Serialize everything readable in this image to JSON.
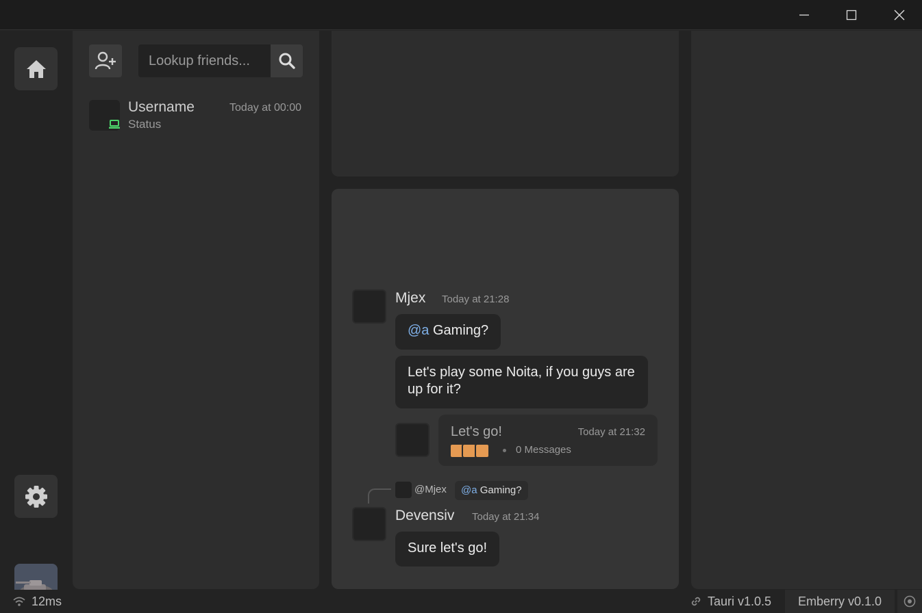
{
  "window": {
    "controls": {
      "minimize": "minimize-icon",
      "maximize": "maximize-icon",
      "close": "close-icon"
    }
  },
  "rail": {
    "home_icon": "home-icon",
    "settings_icon": "gear-icon"
  },
  "friends": {
    "add_friend_icon": "add-user-icon",
    "search": {
      "placeholder": "Lookup friends...",
      "value": ""
    },
    "list": [
      {
        "name": "Username",
        "time": "Today at 00:00",
        "status": "Status",
        "device_icon": "laptop-icon",
        "device_color": "#4cd36a"
      }
    ]
  },
  "chat": {
    "messages": [
      {
        "author": "Mjex",
        "time": "Today at 21:28",
        "bubbles": [
          {
            "mention": "@a",
            "text": " Gaming?"
          },
          {
            "text": "Let's play some Noita, if you guys are up for it?"
          }
        ],
        "thread": {
          "title": "Let's go!",
          "time": "Today at 21:32",
          "count": "0 Messages",
          "participant_color": "#e59a52"
        }
      },
      {
        "reply_to": {
          "author": "@Mjex",
          "mention": "@a",
          "text": " Gaming?"
        },
        "author": "Devensiv",
        "time": "Today at 21:34",
        "bubbles": [
          {
            "text": "Sure let's go!"
          }
        ]
      }
    ]
  },
  "statusbar": {
    "ping": "12ms",
    "tauri_version": "Tauri v1.0.5",
    "app_version": "Emberry v0.1.0"
  },
  "colors": {
    "accent_mention": "#7fb0e8",
    "online": "#4cd36a",
    "thread_avatar": "#e59a52"
  }
}
